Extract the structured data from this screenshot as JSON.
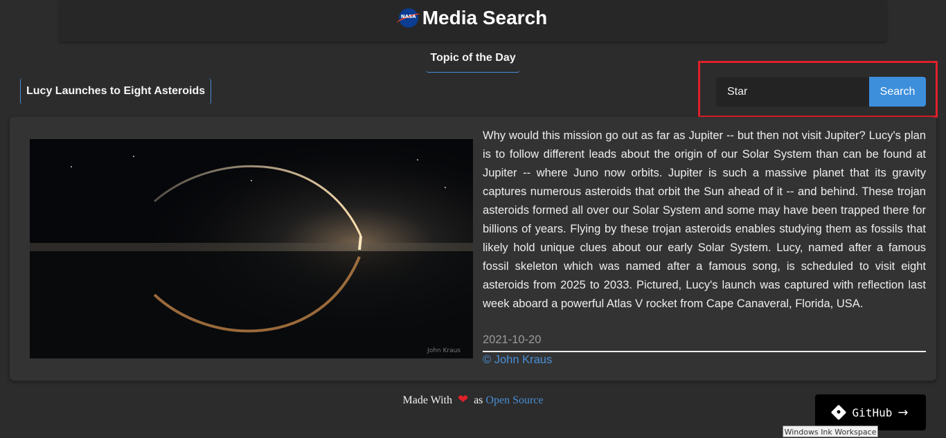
{
  "header": {
    "logo_text": "NASA",
    "title": "Media Search"
  },
  "tabs": {
    "topic_of_day": "Topic of the Day"
  },
  "article": {
    "title": "Lucy Launches to Eight Asteroids",
    "explanation": "Why would this mission go out as far as Jupiter -- but then not visit Jupiter? Lucy's plan is to follow different leads about the origin of our Solar System than can be found at Jupiter -- where Juno now orbits. Jupiter is such a massive planet that its gravity captures numerous asteroids that orbit the Sun ahead of it -- and behind. These trojan asteroids formed all over our Solar System and some may have been trapped there for billions of years. Flying by these trojan asteroids enables studying them as fossils that likely hold unique clues about our early Solar System. Lucy, named after a famous fossil skeleton which was named after a famous song, is scheduled to visit eight asteroids from 2025 to 2033. Pictured, Lucy's launch was captured with reflection last week aboard a powerful Atlas V rocket from Cape Canaveral, Florida, USA.",
    "date": "2021-10-20",
    "copyright": "© John Kraus",
    "image_watermark": "John Kraus"
  },
  "search": {
    "value": "Star",
    "button_label": "Search"
  },
  "footer": {
    "made_with": "Made With",
    "as_text": "as",
    "open_source": "Open Source",
    "github_label": "GitHub"
  },
  "tooltip": {
    "text": "Windows Ink Workspace"
  },
  "colors": {
    "background": "#2c2c2c",
    "accent": "#3d8fdc",
    "highlight": "#e0202a"
  }
}
